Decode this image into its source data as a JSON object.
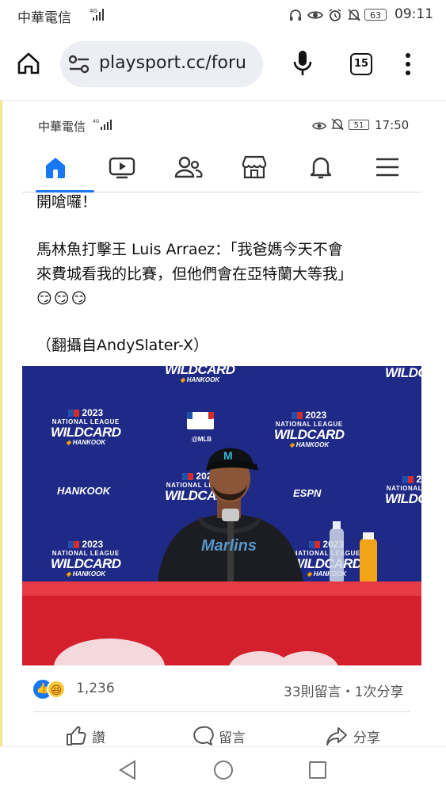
{
  "status_bar": {
    "carrier": "中華電信",
    "signal": "4G",
    "battery": "63",
    "time": "09:11"
  },
  "browser": {
    "url": "playsport.cc/foru",
    "tab_count": "15"
  },
  "inner_status_bar": {
    "carrier": "中華電信",
    "signal": "4G",
    "battery": "51",
    "time": "17:50"
  },
  "fb_nav": {
    "active": "home",
    "items": [
      "home-icon",
      "video-icon",
      "friends-icon",
      "marketplace-icon",
      "notifications-icon",
      "menu-icon"
    ]
  },
  "post": {
    "line1": "開嗆囉！",
    "line2": "馬林魚打擊王 Luis Arraez：「我爸媽今天不會",
    "line3": "來費城看我的比賽，但他們會在亞特蘭大等我」",
    "emojis": "😏😏😏",
    "credit": "（翻攝自AndySlater-X）"
  },
  "photo": {
    "backdrop": {
      "year": "2023",
      "league": "NATIONAL LEAGUE",
      "event": "WILDCARD",
      "sponsor": "HANKOOK",
      "mlb": "@MLB",
      "espn": "ESPN"
    },
    "jersey": "Marlins"
  },
  "reactions": {
    "count": "1,236",
    "comments_shares": "33則留言・1次分享"
  },
  "actions": {
    "like": "讚",
    "comment": "留言",
    "share": "分享"
  },
  "colors": {
    "fb_blue": "#1877f2",
    "backdrop_blue": "#1f2a86",
    "table_red": "#d41f2d"
  }
}
